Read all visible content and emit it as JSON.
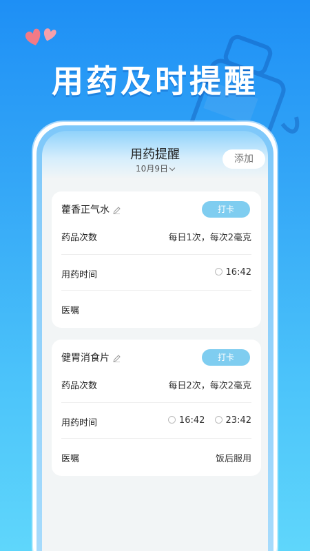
{
  "hero": {
    "title": "用药及时提醒"
  },
  "header": {
    "title": "用药提醒",
    "date": "10月9日",
    "add_label": "添加"
  },
  "colors": {
    "accent": "#7fcdf0",
    "bg_top": "#1e8ff5",
    "bg_bottom": "#5fd6fb"
  },
  "cards": [
    {
      "name": "藿香正气水",
      "punch_label": "打卡",
      "rows": [
        {
          "label": "药品次数",
          "value": "每日1次，每次2毫克"
        },
        {
          "label": "用药时间",
          "times": [
            "16:42"
          ]
        },
        {
          "label": "医嘱",
          "value": ""
        }
      ]
    },
    {
      "name": "健胃消食片",
      "punch_label": "打卡",
      "rows": [
        {
          "label": "药品次数",
          "value": "每日2次，每次2毫克"
        },
        {
          "label": "用药时间",
          "times": [
            "16:42",
            "23:42"
          ]
        },
        {
          "label": "医嘱",
          "value": "饭后服用"
        }
      ]
    }
  ]
}
